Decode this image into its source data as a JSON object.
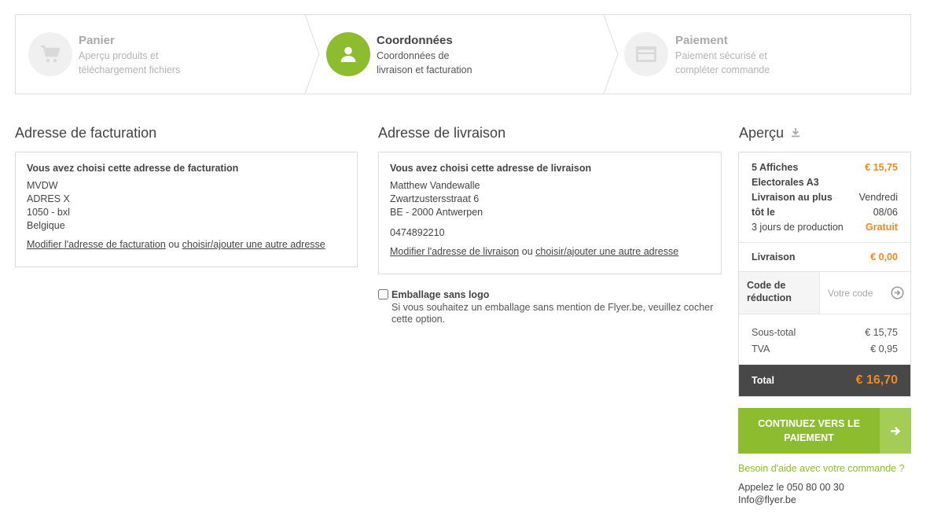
{
  "steps": [
    {
      "title": "Panier",
      "desc_line1": "Aperçu produits et",
      "desc_line2": "téléchargement fichiers",
      "icon": "cart-icon",
      "state": "inactive"
    },
    {
      "title": "Coordonnées",
      "desc_line1": "Coordonnées de",
      "desc_line2": "livraison et facturation",
      "icon": "user-icon",
      "state": "active"
    },
    {
      "title": "Paiement",
      "desc_line1": "Paiement sécurisé et",
      "desc_line2": "compléter commande",
      "icon": "credit-card-icon",
      "state": "inactive"
    }
  ],
  "billing": {
    "title": "Adresse de facturation",
    "box_heading": "Vous avez choisi cette adresse de facturation",
    "lines": [
      "MVDW",
      "ADRES X",
      "1050 - bxl",
      "Belgique"
    ],
    "modify_link": "Modifier l'adresse de facturation",
    "or": "ou",
    "choose_link": "choisir/ajouter une autre adresse"
  },
  "delivery": {
    "title": "Adresse de livraison",
    "box_heading": "Vous avez choisi cette adresse de livraison",
    "lines": [
      "Matthew Vandewalle",
      "Zwartzustersstraat 6",
      "BE - 2000 Antwerpen"
    ],
    "phone": "0474892210",
    "modify_link": "Modifier l'adresse de livraison",
    "or": "ou",
    "choose_link": "choisir/ajouter une autre adresse"
  },
  "packaging": {
    "label": "Emballage sans logo",
    "checked": false,
    "desc_line1": "Si vous souhaitez un emballage sans mention de Flyer.be, veuillez cocher",
    "desc_line2": "cette option."
  },
  "summary": {
    "title": "Aperçu",
    "title_icon": "download-icon",
    "product_line1": "5 Affiches",
    "product_line2": "Electorales A3",
    "product_price": "€ 15,75",
    "delivery_asap_line1": "Livraison au plus",
    "delivery_asap_line2": "tôt le",
    "delivery_day": "Vendredi",
    "delivery_date": "08/06",
    "production": "3 jours de production",
    "production_price": "Gratuit",
    "shipping_label": "Livraison",
    "shipping_price": "€ 0,00",
    "code_label_line1": "Code de",
    "code_label_line2": "réduction",
    "code_placeholder": "Votre code",
    "subtotal_label": "Sous-total",
    "subtotal_value": "€ 15,75",
    "tax_label": "TVA",
    "tax_value": "€ 0,95",
    "total_label": "Total",
    "total_value": "€ 16,70"
  },
  "cta": {
    "line1": "CONTINUEZ VERS LE",
    "line2": "PAIEMENT",
    "icon": "arrow-right-icon"
  },
  "help": {
    "link": "Besoin d'aide avec votre commande ?",
    "phone": "Appelez le 050 80 00 30",
    "email": "Info@flyer.be"
  },
  "colors": {
    "accent_green": "#8dbd2f",
    "accent_orange": "#f18a1c",
    "total_bg": "#484848"
  }
}
